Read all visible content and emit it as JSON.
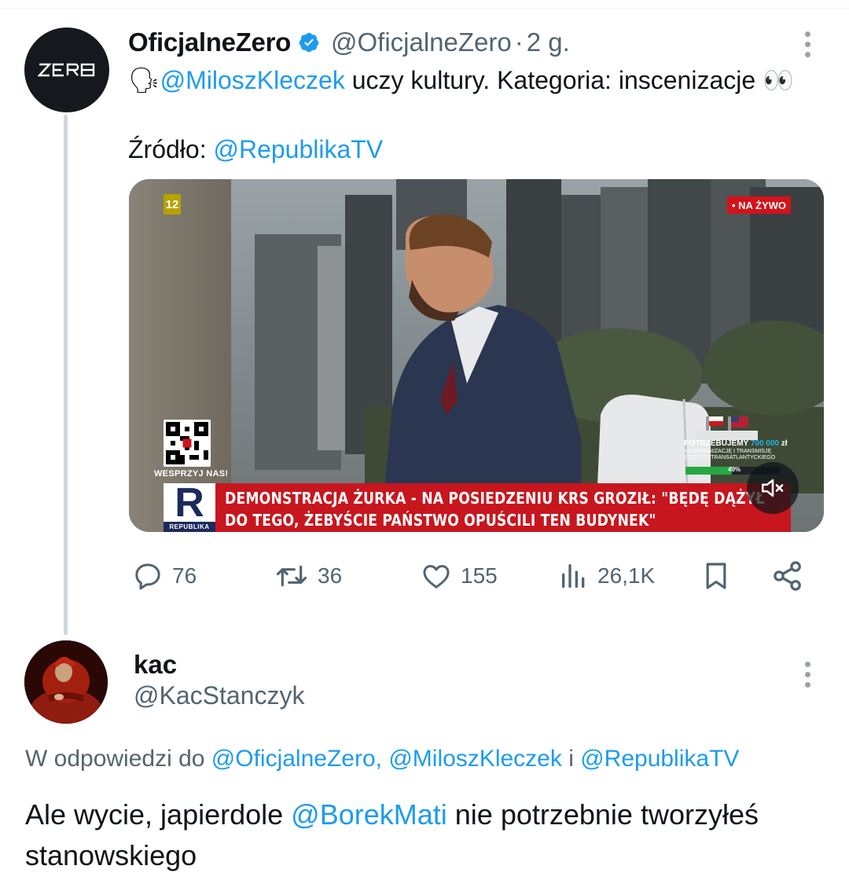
{
  "tweet": {
    "author_name": "OficjalneZero",
    "author_handle": "@OficjalneZero",
    "separator": "·",
    "time": "2 g.",
    "avatar_text": "ZERO",
    "text_emoji_prefix": "🗣",
    "text_mention": "@MiloszKleczek",
    "text_body": " uczy kultury. Kategoria: inscenizacje ",
    "text_emoji_suffix": "👀",
    "source_label": "Źródło: ",
    "source_mention": "@RepublikaTV",
    "video": {
      "channel_badge": "12",
      "live_badge": "• NA ŻYWO",
      "qr_label": "WESPRZYJ NAS!",
      "donation_line1_prefix": "POTRZEBUJEMY ",
      "donation_amount": "700 000",
      "donation_unit": " zł",
      "donation_line2": "NA ORGANIZACJĘ I TRANSMISJĘ SZCZYTU TRANSATLANTYCKIEGO",
      "donation_progress": 0.49,
      "donation_pct_label": "49%",
      "logo_letter": "R",
      "logo_caption": "REPUBLIKA",
      "ticker_line1": "DEMONSTRACJA ŻURKA - NA POSIEDZENIU KRS GROZIŁ: \"BĘDĘ DĄŻYŁ",
      "ticker_line2": "DO TEGO, ŻEBYŚCIE PAŃSTWO OPUŚCILI TEN BUDYNEK\"",
      "muted": true
    },
    "actions": {
      "replies": "76",
      "reposts": "36",
      "likes": "155",
      "views": "26,1K"
    }
  },
  "reply": {
    "author_name": "kac",
    "author_handle": "@KacStanczyk",
    "reply_to_prefix": "W odpowiedzi do ",
    "reply_to_mention1": "@OficjalneZero,",
    "reply_to_mention2": "@MiloszKleczek",
    "reply_to_joiner": " i ",
    "reply_to_mention3": "@RepublikaTV",
    "text_part1": "Ale wycie, japierdole ",
    "text_mention": "@BorekMati",
    "text_part2": " nie potrzebnie tworzyłeś stanowskiego"
  },
  "colors": {
    "link": "#1d9bf0",
    "secondary_text": "#536471",
    "primary_text": "#0f1419",
    "verified": "#1d9bf0",
    "ticker_bg": "#c8161e"
  },
  "icons": [
    "verified-badge-icon",
    "more-options-icon",
    "reply-icon",
    "repost-icon",
    "like-icon",
    "views-icon",
    "bookmark-icon",
    "share-icon",
    "mute-icon"
  ]
}
